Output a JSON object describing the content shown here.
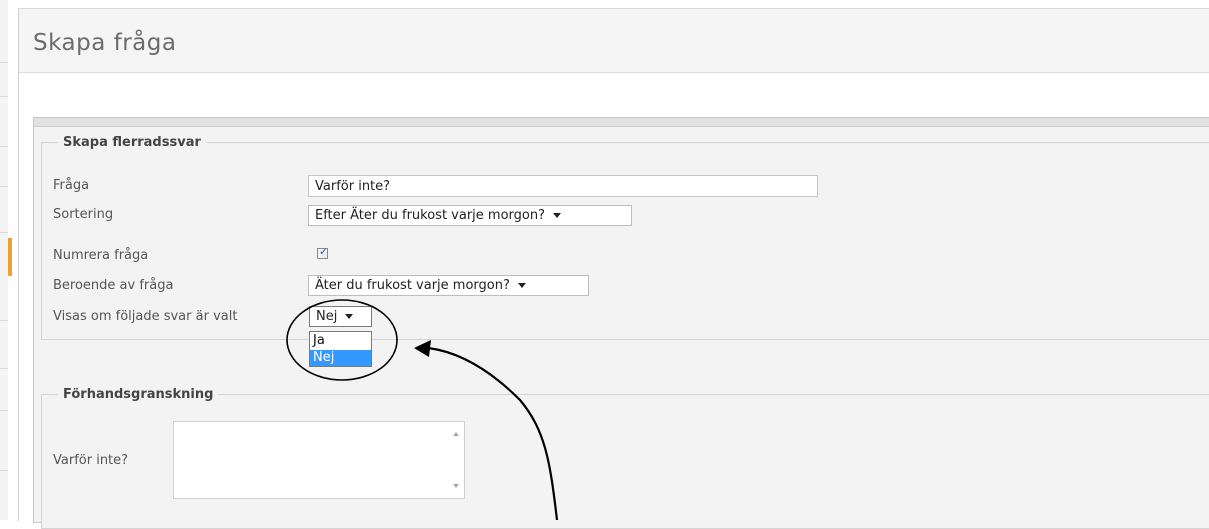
{
  "window": {
    "title": "Skapa fråga"
  },
  "create_section": {
    "legend": "Skapa flerradssvar",
    "question_label": "Fråga",
    "question_value": "Varför inte?",
    "sorting_label": "Sortering",
    "sorting_value": "Efter Äter du frukost varje morgon?",
    "number_label": "Numrera fråga",
    "number_checked": true,
    "depends_label": "Beroende av fråga",
    "depends_value": "Äter du frukost varje morgon?",
    "shown_if_label": "Visas om följade svar är valt",
    "shown_if_value": "Nej",
    "shown_if_options": [
      "Ja",
      "Nej"
    ],
    "shown_if_highlighted": "Nej"
  },
  "preview_section": {
    "legend": "Förhandsgranskning",
    "question_label": "Varför inte?"
  },
  "icons": {
    "dropdown": "chevron-down-icon",
    "checkbox": "check-icon",
    "scroll_up": "scroll-up-icon",
    "scroll_down": "scroll-down-icon"
  },
  "colors": {
    "highlight": "#3399ff",
    "accent": "#f0a030",
    "annotation": "#000000"
  }
}
